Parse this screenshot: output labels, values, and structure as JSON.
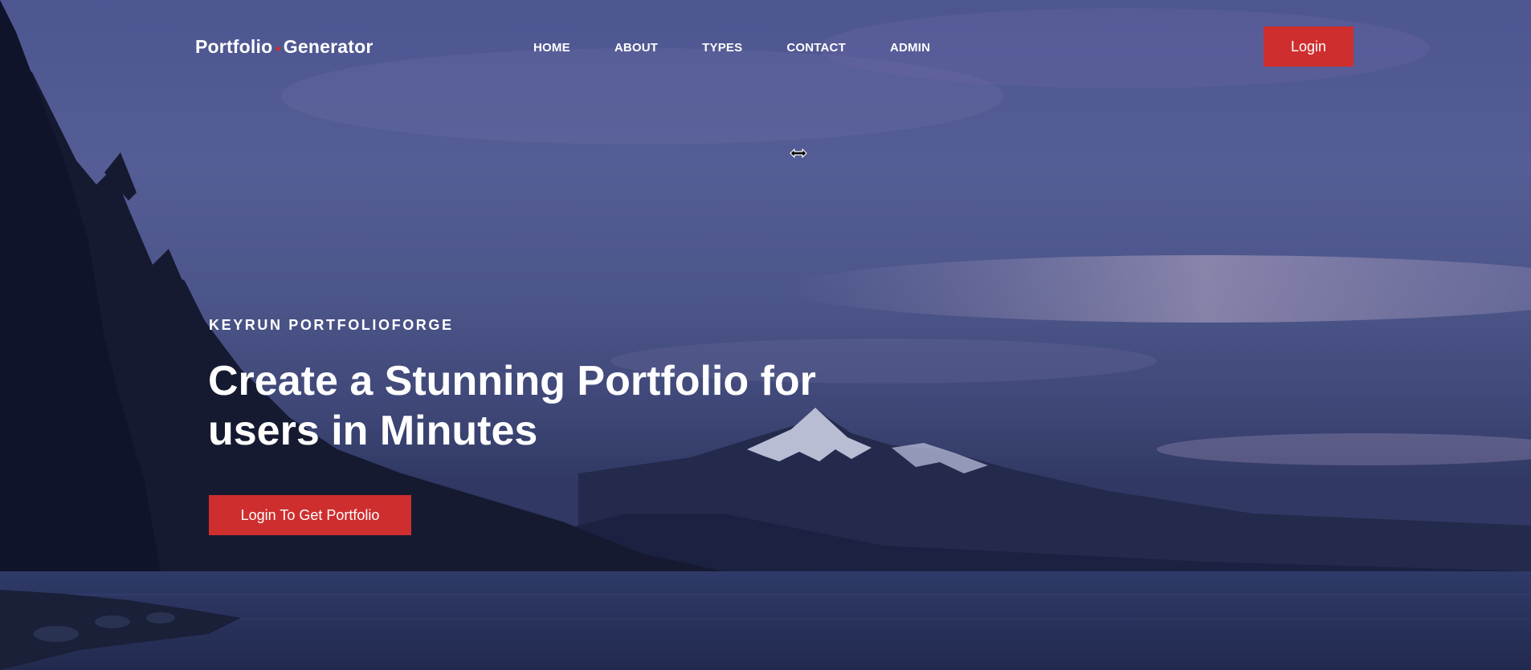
{
  "header": {
    "brand": {
      "left": "Portfolio",
      "separator": "●",
      "right": "Generator"
    },
    "nav": [
      {
        "label": "HOME"
      },
      {
        "label": "ABOUT"
      },
      {
        "label": "TYPES"
      },
      {
        "label": "CONTACT"
      },
      {
        "label": "ADMIN"
      }
    ],
    "login_label": "Login"
  },
  "hero": {
    "kicker": "KEYRUN PORTFOLIOFORGE",
    "headline_line1": "Create a Stunning Portfolio for",
    "headline_line2": "users in Minutes",
    "cta_label": "Login To Get Portfolio"
  },
  "cursor": {
    "icon": "resize-horizontal-icon"
  },
  "colors": {
    "accent": "#cf2e2e",
    "text": "#ffffff",
    "sky_top": "#4a5288",
    "water": "#263058"
  }
}
